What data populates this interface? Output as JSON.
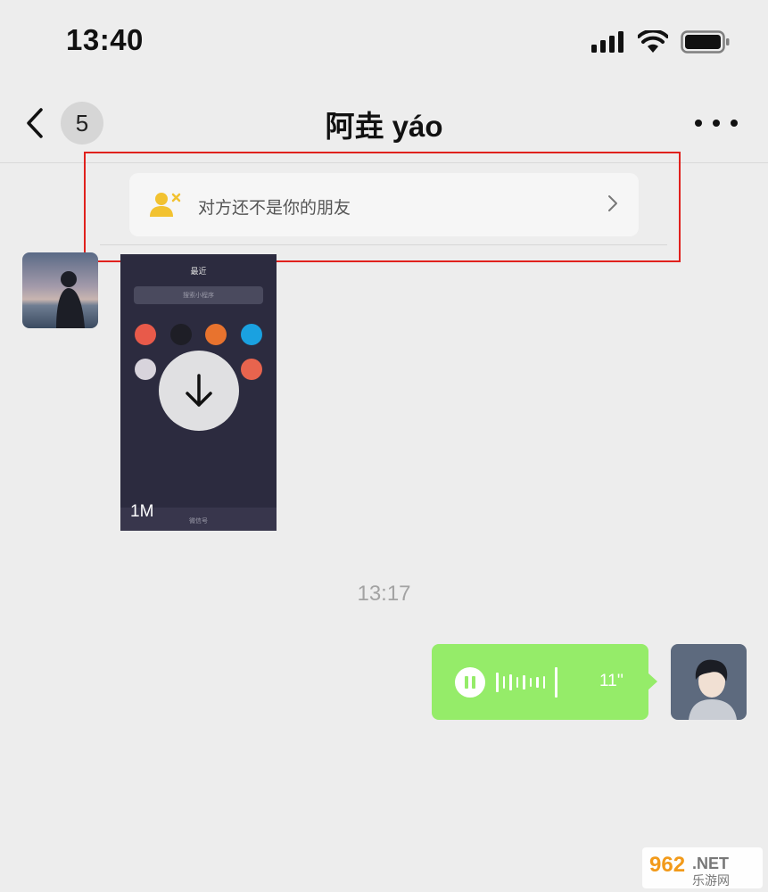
{
  "status_bar": {
    "time": "13:40"
  },
  "nav": {
    "unread_count": "5",
    "title": "阿垚 yáo"
  },
  "notice": {
    "text": "对方还不是你的朋友"
  },
  "messages": {
    "image": {
      "size": "1M",
      "preview_title": "最近",
      "preview_search": "搜索小程序",
      "preview_bottom": "微信号"
    },
    "timestamp": "13:17",
    "voice": {
      "duration": "11''"
    }
  },
  "watermark": {
    "text": "962.NET",
    "subtext": "乐游网"
  },
  "colors": {
    "background": "#ededed",
    "voice_bubble": "#95ec69",
    "highlight_box": "#e0211d",
    "notice_icon": "#f2c230"
  }
}
